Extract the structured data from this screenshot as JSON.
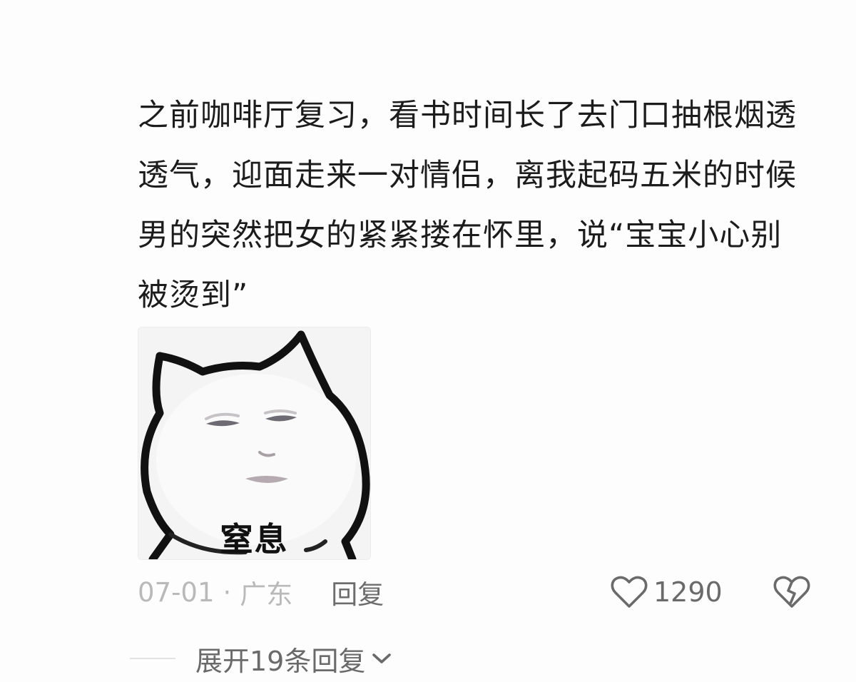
{
  "comment": {
    "text": "之前咖啡厅复习，看书时间长了去门口抽根烟透透气，迎面走来一对情侣，离我起码五米的时候男的突然把女的紧紧搂在怀里，说“宝宝小心别被烫到”"
  },
  "sticker": {
    "caption": "窒息"
  },
  "meta": {
    "date": "07-01",
    "separator": "·",
    "location": "广东",
    "reply_label": "回复"
  },
  "actions": {
    "like_count": "1290",
    "like_icon": "heart-outline-icon",
    "dislike_icon": "broken-heart-icon"
  },
  "expand": {
    "label": "展开19条回复",
    "icon": "chevron-down-icon"
  }
}
